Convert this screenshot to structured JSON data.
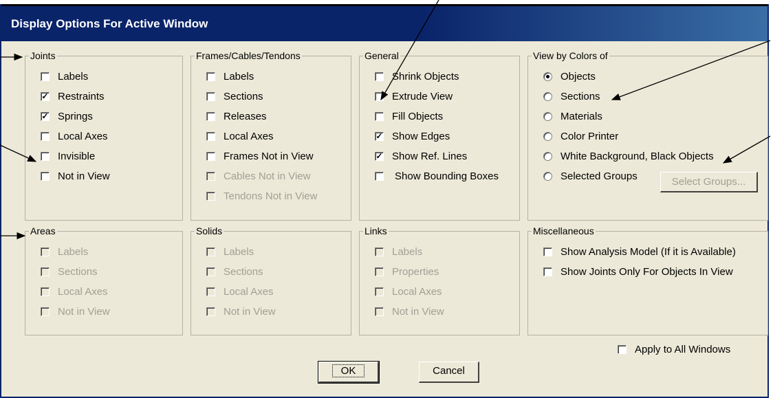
{
  "title": "Display Options For Active Window",
  "groups": {
    "joints": {
      "label": "Joints",
      "items": [
        "Labels",
        "Restraints",
        "Springs",
        "Local Axes",
        "Invisible",
        "Not in View"
      ],
      "checked": [
        false,
        true,
        true,
        false,
        false,
        false
      ]
    },
    "frames": {
      "label": "Frames/Cables/Tendons",
      "items": [
        "Labels",
        "Sections",
        "Releases",
        "Local Axes",
        "Frames Not in View",
        "Cables Not in View",
        "Tendons Not in View"
      ],
      "disabled": [
        false,
        false,
        false,
        false,
        false,
        true,
        true
      ]
    },
    "general": {
      "label": "General",
      "items": [
        "Shrink Objects",
        "Extrude View",
        "Fill Objects",
        "Show Edges",
        "Show Ref. Lines",
        "Show Bounding Boxes"
      ],
      "checked": [
        false,
        false,
        false,
        true,
        true,
        false
      ]
    },
    "view_colors": {
      "label": "View by Colors of",
      "items": [
        "Objects",
        "Sections",
        "Materials",
        "Color Printer",
        "White Background, Black Objects",
        "Selected Groups"
      ],
      "selected": "Objects",
      "select_groups_button": "Select Groups..."
    },
    "areas": {
      "label": "Areas",
      "items": [
        "Labels",
        "Sections",
        "Local Axes",
        "Not in View"
      ],
      "disabled": true
    },
    "solids": {
      "label": "Solids",
      "items": [
        "Labels",
        "Sections",
        "Local Axes",
        "Not in View"
      ],
      "disabled": true
    },
    "links": {
      "label": "Links",
      "items": [
        "Labels",
        "Properties",
        "Local Axes",
        "Not in View"
      ],
      "disabled": true
    },
    "misc": {
      "label": "Miscellaneous",
      "items": [
        "Show Analysis Model  (If it is Available)",
        "Show Joints Only For Objects In View"
      ]
    }
  },
  "apply_all": "Apply to All Windows",
  "ok_label": "OK",
  "cancel_label": "Cancel"
}
